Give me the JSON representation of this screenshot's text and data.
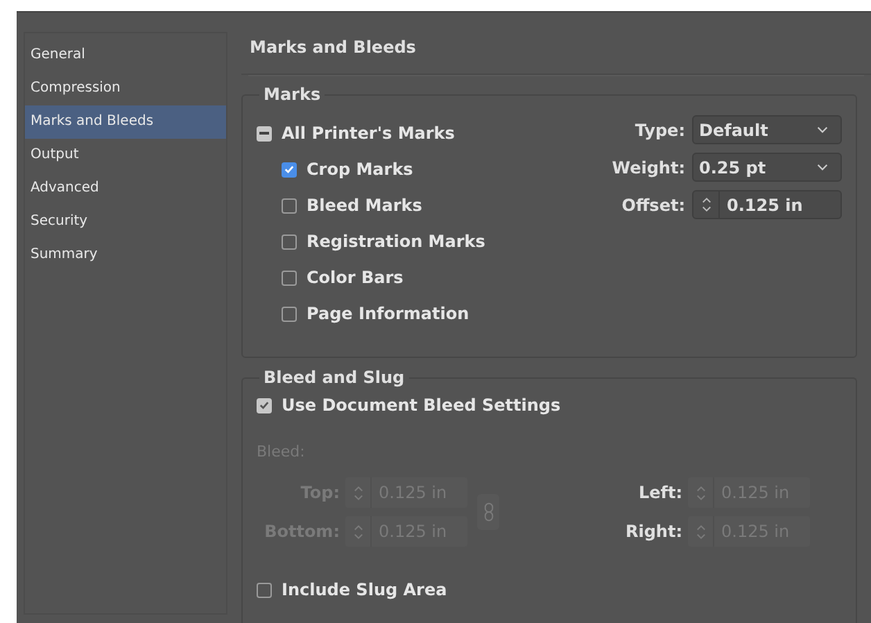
{
  "sidebar": {
    "items": [
      {
        "label": "General",
        "selected": false
      },
      {
        "label": "Compression",
        "selected": false
      },
      {
        "label": "Marks and Bleeds",
        "selected": true
      },
      {
        "label": "Output",
        "selected": false
      },
      {
        "label": "Advanced",
        "selected": false
      },
      {
        "label": "Security",
        "selected": false
      },
      {
        "label": "Summary",
        "selected": false
      }
    ]
  },
  "header": "Marks and Bleeds",
  "marks": {
    "title": "Marks",
    "all": {
      "label": "All Printer's Marks",
      "mixed": true
    },
    "items": [
      {
        "label": "Crop Marks",
        "checked": true
      },
      {
        "label": "Bleed Marks",
        "checked": false
      },
      {
        "label": "Registration Marks",
        "checked": false
      },
      {
        "label": "Color Bars",
        "checked": false
      },
      {
        "label": "Page Information",
        "checked": false
      }
    ],
    "settings": [
      {
        "kind": "dropdown",
        "label": "Type:",
        "value": "Default"
      },
      {
        "kind": "dropdown",
        "label": "Weight:",
        "value": "0.25 pt"
      },
      {
        "kind": "spinner",
        "label": "Offset:",
        "value": "0.125 in"
      }
    ]
  },
  "bleed_and_slug": {
    "title": "Bleed and Slug",
    "use_document": {
      "label": "Use Document Bleed Settings",
      "checked": true
    },
    "bleed_label": "Bleed:",
    "disabled": true,
    "fields": [
      {
        "label": "Top:",
        "value": "0.125 in",
        "label_disabled": true
      },
      {
        "label": "Left:",
        "value": "0.125 in",
        "label_disabled": false
      },
      {
        "label": "Bottom:",
        "value": "0.125 in",
        "label_disabled": true
      },
      {
        "label": "Right:",
        "value": "0.125 in",
        "label_disabled": false
      }
    ],
    "include_slug": {
      "label": "Include Slug Area",
      "checked": false
    }
  }
}
